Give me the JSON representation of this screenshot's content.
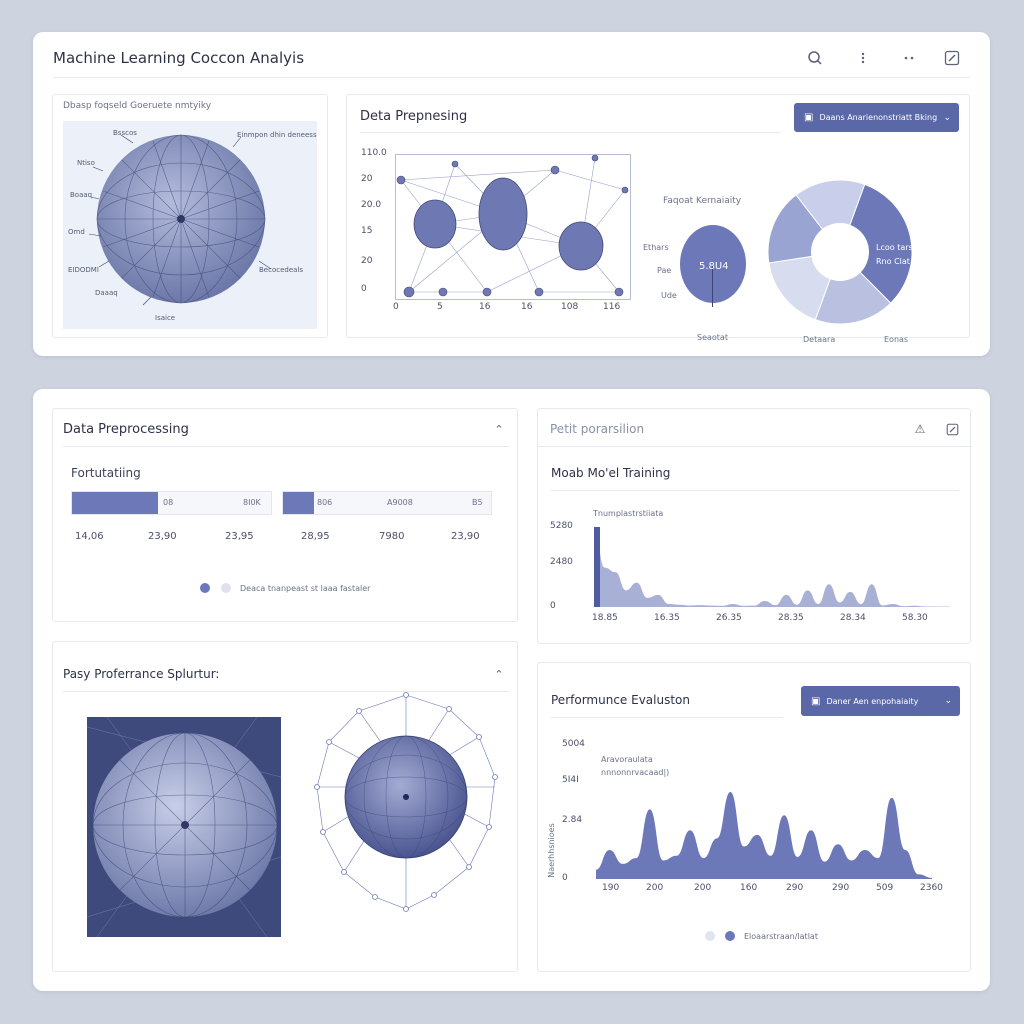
{
  "header": {
    "title": "Machine Learning Coccon Analyis",
    "icons": [
      "search-icon",
      "more-vertical-icon",
      "more-horizontal-icon",
      "edit-icon"
    ]
  },
  "top_left": {
    "caption": "Dbasp foqseld Goeruete nmtyiky",
    "sphere_labels": [
      "Bsscos",
      "Einmpon dhin deneess",
      "Ntiso",
      "Boaaq",
      "Omd",
      "EIDODMI",
      "Becocedeals",
      "Daaaq",
      "Isaice"
    ]
  },
  "top_middle": {
    "title": "Deta Prepnesing",
    "y_ticks": [
      "110.0",
      "20",
      "20.0",
      "15",
      "20",
      "0"
    ],
    "x_ticks": [
      "0",
      "5",
      "16",
      "16",
      "108",
      "116"
    ],
    "chart_data": {
      "type": "scatter",
      "x": [
        0,
        5,
        16,
        16,
        108,
        116
      ],
      "y": [],
      "xlabel": "",
      "ylabel": "",
      "grid": false
    }
  },
  "top_right": {
    "button_label": "Daans Anarienonstriatt Bking",
    "subtitle": "Faqoat Kernaiaity",
    "oval_label": "5.8U4",
    "oval_side_labels": [
      "Ethars",
      "Pae",
      "Ude"
    ],
    "oval_bottom": "Seaotat",
    "donut_labels": [
      "Lcoo tarsfeld",
      "Rno Clat"
    ],
    "donut_bottom": [
      "Detaara",
      "Eonas"
    ],
    "chart_data": {
      "type": "pie",
      "labels": [
        "Lcoo tarsfeld",
        "Rno Clat",
        "",
        "",
        ""
      ],
      "values": [
        32,
        18,
        17,
        17,
        16
      ],
      "colors": [
        "#6c78b8",
        "#b9c0e0",
        "#d8dcef",
        "#9aa4d2",
        "#c9cfea"
      ]
    }
  },
  "data_prep": {
    "title": "Data Preprocessing",
    "subtitle": "Fortutatiing",
    "bar1": {
      "fill": 0.43,
      "labels": [
        "08",
        "8I0K"
      ]
    },
    "bar2": {
      "fill": 0.15,
      "labels": [
        "806",
        "A9008",
        "B5"
      ]
    },
    "values": [
      "14,06",
      "23,90",
      "23,95",
      "28,95",
      "7980",
      "23,90"
    ],
    "legend": "Deaca tnanpeast st laaa fastaler"
  },
  "parallel": {
    "title": "Pasy Proferrance Splurtur:"
  },
  "model_training": {
    "tab": "Petit porarsilion",
    "title": "Moab Mo'el Training",
    "chart_caption": "Tnumplastrstiiata",
    "y_ticks": [
      "5280",
      "2480",
      "0"
    ],
    "x_ticks": [
      "18.85",
      "16.35",
      "26.35",
      "28.35",
      "28.34",
      "58.30"
    ],
    "chart_data": {
      "type": "area",
      "x": [
        0,
        3,
        6,
        9,
        12,
        15,
        18,
        21,
        24,
        27,
        30,
        33,
        36,
        39,
        42,
        45,
        48,
        51,
        54,
        57,
        60,
        63,
        66,
        69,
        72,
        75,
        78,
        81,
        84,
        87,
        90,
        93,
        96,
        100
      ],
      "y": [
        5280,
        2600,
        2300,
        1100,
        1600,
        600,
        800,
        200,
        150,
        100,
        120,
        90,
        80,
        200,
        80,
        90,
        400,
        120,
        800,
        150,
        1100,
        200,
        1500,
        300,
        1000,
        200,
        1500,
        100,
        200,
        50,
        80,
        30,
        20,
        10
      ],
      "ylim": [
        0,
        5280
      ]
    }
  },
  "performance": {
    "title": "Performunce Evaluston",
    "button_label": "Daner Aen enpohaiaity",
    "caption_line1": "Aravoraulata",
    "caption_line2": "nnnonnrvacaad|)",
    "ylabel": "Naerhhsnioes",
    "y_ticks": [
      "5004",
      "5I4I",
      "2.84",
      "0"
    ],
    "x_ticks": [
      "190",
      "200",
      "200",
      "160",
      "290",
      "290",
      "509",
      "2360"
    ],
    "legend": "Eloaarstraan/latlat",
    "chart_data": {
      "type": "area",
      "x": [
        0,
        4,
        8,
        12,
        16,
        20,
        24,
        28,
        32,
        36,
        40,
        44,
        48,
        52,
        56,
        60,
        64,
        68,
        72,
        76,
        80,
        84,
        88,
        92,
        96,
        100
      ],
      "y": [
        80,
        250,
        130,
        180,
        600,
        160,
        200,
        420,
        180,
        350,
        750,
        280,
        380,
        200,
        550,
        190,
        420,
        150,
        300,
        160,
        250,
        180,
        700,
        250,
        40,
        10
      ],
      "ylim": [
        0,
        1000
      ]
    }
  }
}
